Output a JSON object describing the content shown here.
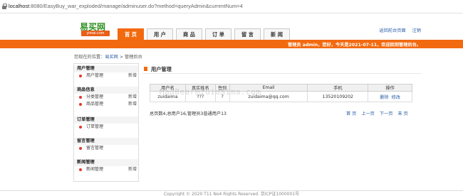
{
  "browser": {
    "url_host": "localhost",
    "url_rest": ":8080/EasyBuy_war_exploded/manage/adminuser.do?method=queryAdmin&currentNum=4"
  },
  "logo": {
    "text": "易买网",
    "sub": "yimai.com"
  },
  "nav": {
    "tabs": [
      "首 页",
      "用 户",
      "商 品",
      "订 单",
      "留 言",
      "新 闻"
    ],
    "active_index": 0
  },
  "toplinks": [
    "返回前台页面",
    "注销"
  ],
  "welcome": "管理员 admin，您好，今天是2021-07-11，欢迎回到管理后台。",
  "breadcrumb": {
    "prefix": "您现在的位置：",
    "home": "易买网",
    "sep": " > ",
    "current": "管理后台"
  },
  "sidebar": [
    {
      "title": "用户管理",
      "items": [
        {
          "label": "用户管理",
          "extra": "新增"
        }
      ]
    },
    {
      "title": "商品信息",
      "items": [
        {
          "label": "分类管理",
          "extra": "新增"
        },
        {
          "label": "商品管理",
          "extra": "新增"
        }
      ]
    },
    {
      "title": "订单管理",
      "items": [
        {
          "label": "订单管理",
          "extra": ""
        }
      ]
    },
    {
      "title": "留言管理",
      "items": [
        {
          "label": "留言管理",
          "extra": ""
        }
      ]
    },
    {
      "title": "新闻管理",
      "items": [
        {
          "label": "新闻管理",
          "extra": "新增"
        }
      ]
    }
  ],
  "main": {
    "title": "用户管理",
    "columns": [
      "用户名",
      "真实姓名",
      "性别",
      "Email",
      "手机",
      "操作"
    ],
    "rows": [
      {
        "username": "zuidaima",
        "realname": "???",
        "sex": "?",
        "email": "zuidaima@qq.com",
        "phone": "13520109202",
        "actions": [
          "删除",
          "修改"
        ]
      }
    ],
    "summary": "总页数4,总用户16,管理员3普通用户13",
    "pager": [
      "首 页",
      "上一页",
      "下一页",
      "末 页"
    ],
    "watermark": "MadBear@zuidaima.com"
  },
  "footer": "Copyright © 2020 T11 No4 Rights Reserved. 京ICP证1000001号",
  "colors": {
    "accent": "#f26a10",
    "link": "#2b5ea8",
    "logo_green": "#2f8f1f"
  }
}
